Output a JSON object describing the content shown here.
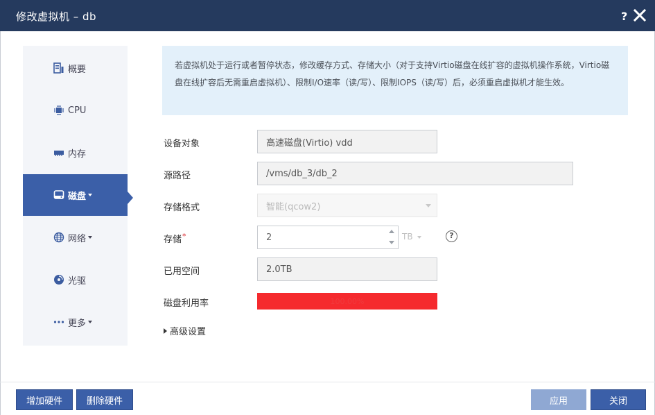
{
  "window": {
    "title": "修改虚拟机 – db",
    "help_label": "?"
  },
  "sidebar": {
    "items": [
      {
        "label": "概要",
        "icon": "summary-icon"
      },
      {
        "label": "CPU",
        "icon": "cpu-icon"
      },
      {
        "label": "内存",
        "icon": "memory-icon"
      },
      {
        "label": "磁盘",
        "icon": "disk-icon",
        "active": true
      },
      {
        "label": "网络",
        "icon": "network-icon"
      },
      {
        "label": "光驱",
        "icon": "cdrom-icon"
      },
      {
        "label": "更多",
        "icon": "more-icon"
      }
    ]
  },
  "notice": {
    "text": "若虚拟机处于运行或者暂停状态，修改缓存方式、存储大小（对于支持Virtio磁盘在线扩容的虚拟机操作系统，Virtio磁盘在线扩容后无需重启虚拟机）、限制I/O速率（读/写）、限制IOPS（读/写）后，必须重启虚拟机才能生效。"
  },
  "form": {
    "device": {
      "label": "设备对象",
      "value": "高速磁盘(Virtio) vdd"
    },
    "source_path": {
      "label": "源路径",
      "value": "/vms/db_3/db_2"
    },
    "format": {
      "label": "存储格式",
      "value": "智能(qcow2)"
    },
    "storage": {
      "label": "存储",
      "required_mark": "*",
      "value": "2",
      "unit": "TB"
    },
    "used_space": {
      "label": "已用空间",
      "value": "2.0TB"
    },
    "disk_usage": {
      "label": "磁盘利用率",
      "text": "100.00%",
      "fraction": 1.0
    },
    "advanced": {
      "label": "高级设置"
    }
  },
  "footer": {
    "add_hw": "增加硬件",
    "del_hw": "删除硬件",
    "apply": "应用",
    "close": "关闭"
  },
  "colors": {
    "titlebar": "#253a5e",
    "accent": "#3b5fa8",
    "usage_bar": "#f52a2e",
    "notice_bg": "#e3f0fa"
  }
}
